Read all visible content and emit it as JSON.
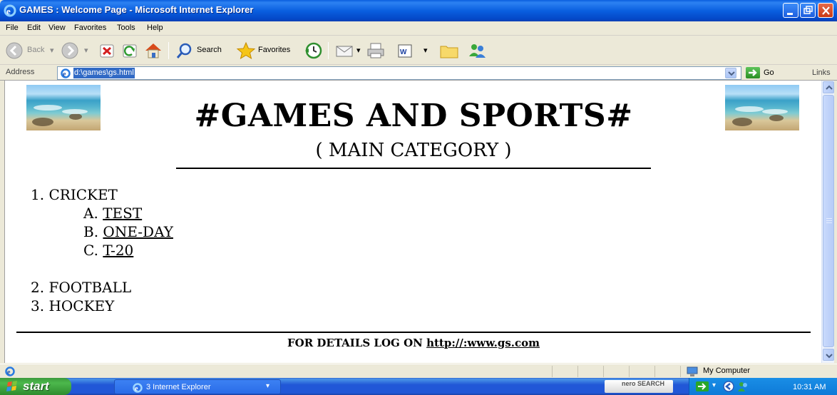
{
  "window": {
    "title": "GAMES : Welcome Page - Microsoft Internet Explorer"
  },
  "menu": [
    "File",
    "Edit",
    "View",
    "Favorites",
    "Tools",
    "Help"
  ],
  "toolbar": {
    "back_label": "Back",
    "search_label": "Search",
    "favorites_label": "Favorites"
  },
  "address": {
    "label": "Address",
    "value": "d:\\games\\gs.html",
    "go_label": "Go",
    "links_label": "Links"
  },
  "page": {
    "heading": "#GAMES AND SPORTS#",
    "subheading": "( MAIN CATEGORY )",
    "list": {
      "item1": {
        "number": "1.",
        "label": "CRICKET"
      },
      "sub": [
        {
          "letter": "A.",
          "label": "TEST"
        },
        {
          "letter": "B.",
          "label": "ONE-DAY"
        },
        {
          "letter": "C.",
          "label": "T-20"
        }
      ],
      "item2": {
        "number": "2.",
        "label": "FOOTBALL"
      },
      "item3": {
        "number": "3.",
        "label": "HOCKEY"
      }
    },
    "footer_prefix": "FOR DETAILS LOG ON",
    "footer_link": "http://:www.gs.com"
  },
  "statusbar": {
    "zone": "My Computer"
  },
  "taskbar": {
    "start_label": "start",
    "task_label": "3 Internet Explorer",
    "nero_label": "nero SEARCH",
    "clock": "10:31 AM"
  },
  "colors": {
    "titlebar": "#0a5fe0",
    "taskbar": "#2157d7",
    "start_button": "#3c9a3c",
    "address_highlight": "#316ac5"
  },
  "icons": [
    "ie-icon",
    "minimize-icon",
    "maximize-icon",
    "close-icon",
    "windows-flag-icon",
    "back-icon",
    "forward-icon",
    "stop-icon",
    "refresh-icon",
    "home-icon",
    "search-icon",
    "favorites-star-icon",
    "history-icon",
    "mail-icon",
    "print-icon",
    "word-icon",
    "folder-icon",
    "messenger-icon",
    "go-arrow-icon",
    "chevron-down-icon",
    "computer-icon"
  ]
}
